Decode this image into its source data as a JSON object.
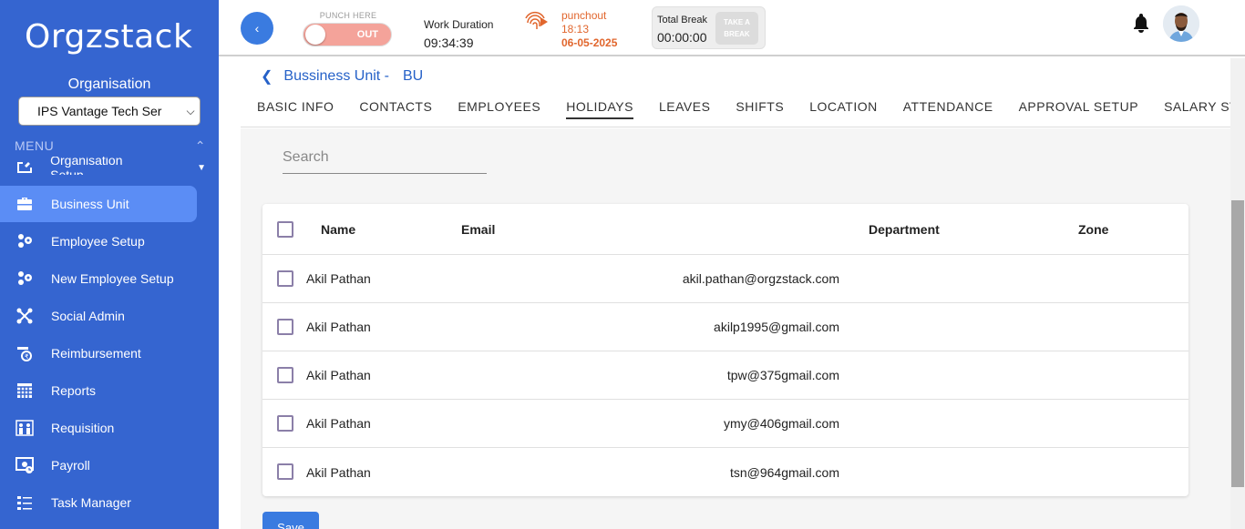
{
  "app": {
    "logo": "Orgzstack"
  },
  "sidebar": {
    "org_label": "Organisation",
    "org_select_value": "IPS Vantage Tech Ser",
    "menu_label": "MENU",
    "partial_item": "Organisation Setup",
    "items": [
      {
        "label": "Business Unit",
        "icon": "briefcase-icon"
      },
      {
        "label": "Employee Setup",
        "icon": "people-gear-icon"
      },
      {
        "label": "New Employee Setup",
        "icon": "people-gear-icon"
      },
      {
        "label": "Social Admin",
        "icon": "molecule-icon"
      },
      {
        "label": "Reimbursement",
        "icon": "reimbursement-icon"
      },
      {
        "label": "Reports",
        "icon": "grid-icon"
      },
      {
        "label": "Requisition",
        "icon": "people-icon"
      },
      {
        "label": "Payroll",
        "icon": "payroll-icon"
      },
      {
        "label": "Task Manager",
        "icon": "task-list-icon"
      }
    ]
  },
  "header": {
    "punch_label": "PUNCH HERE",
    "toggle_text": "OUT",
    "work_duration_label": "Work Duration",
    "work_duration_value": "09:34:39",
    "punchout_label": "punchout",
    "punchout_time": "18:13",
    "punchout_date": "06-05-2025",
    "total_break_label": "Total Break",
    "total_break_value": "00:00:00",
    "take_break_line1": "TAKE A",
    "take_break_line2": "BREAK"
  },
  "breadcrumb": {
    "title": "Bussiness Unit -",
    "code": "BU"
  },
  "tabs": [
    "BASIC INFO",
    "CONTACTS",
    "EMPLOYEES",
    "HOLIDAYS",
    "LEAVES",
    "SHIFTS",
    "LOCATION",
    "ATTENDANCE",
    "APPROVAL SETUP",
    "SALARY STRUCTUR"
  ],
  "active_tab": "HOLIDAYS",
  "search": {
    "placeholder": "Search"
  },
  "table": {
    "headers": {
      "name": "Name",
      "email": "Email",
      "department": "Department",
      "zone": "Zone"
    },
    "rows": [
      {
        "name": "Akil Pathan",
        "email": "akil.pathan@orgzstack.com",
        "department": "",
        "zone": ""
      },
      {
        "name": "Akil Pathan",
        "email": "akilp1995@gmail.com",
        "department": "",
        "zone": ""
      },
      {
        "name": "Akil Pathan",
        "email": "tpw@375gmail.com",
        "department": "",
        "zone": ""
      },
      {
        "name": "Akil Pathan",
        "email": "ymy@406gmail.com",
        "department": "",
        "zone": ""
      },
      {
        "name": "Akil Pathan",
        "email": "tsn@964gmail.com",
        "department": "",
        "zone": ""
      }
    ]
  },
  "save_label": "Save",
  "colors": {
    "sidebar": "#3565d0",
    "active_item": "#5b8df5",
    "primary": "#3a7be0",
    "punchout": "#e1662d",
    "toggle": "#f4a39a"
  }
}
